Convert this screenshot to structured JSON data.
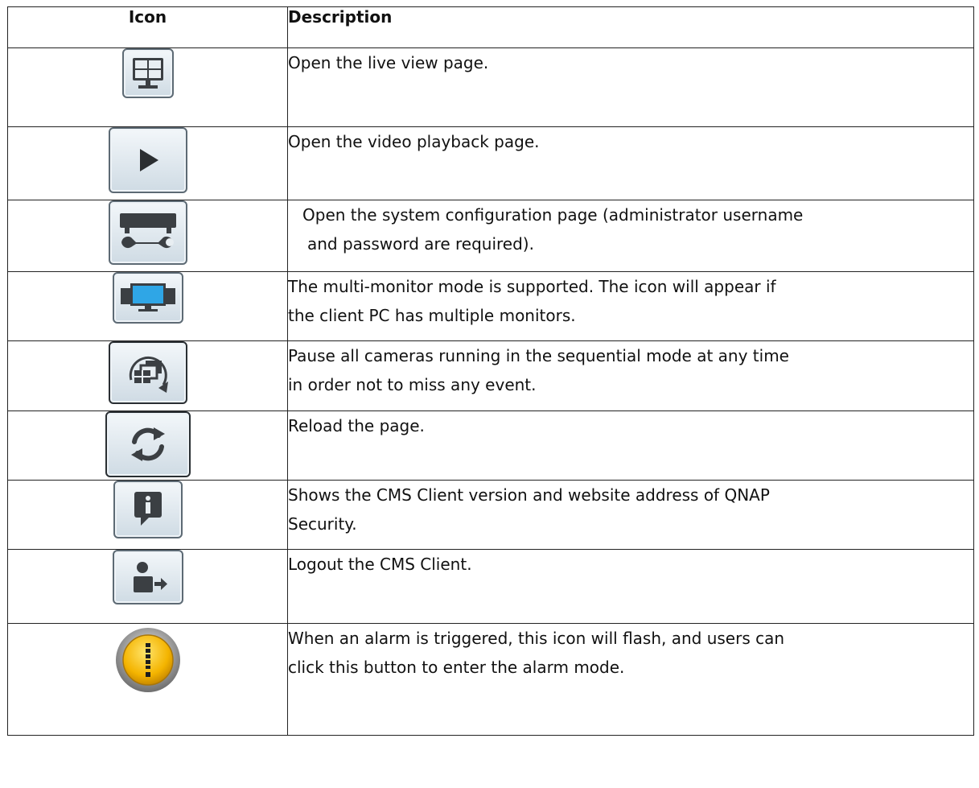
{
  "table": {
    "headers": {
      "icon": "Icon",
      "description": "Description"
    },
    "rows": [
      {
        "icon": "live-view-monitor-icon",
        "description_lines": [
          "Open the live view page."
        ]
      },
      {
        "icon": "playback-icon",
        "description_lines": [
          "Open the video playback page."
        ]
      },
      {
        "icon": "system-config-icon",
        "description_lines": [
          "Open the system configuration page (administrator username",
          "and password are required)."
        ]
      },
      {
        "icon": "multi-monitor-icon",
        "description_lines": [
          "The multi-monitor mode is supported. The icon will appear if",
          "the client PC has multiple monitors."
        ]
      },
      {
        "icon": "pause-sequential-icon",
        "description_lines": [
          "Pause all cameras running in the sequential mode at any time",
          "in order not to miss any event."
        ]
      },
      {
        "icon": "reload-icon",
        "description_lines": [
          "Reload the page."
        ]
      },
      {
        "icon": "info-icon",
        "description_lines": [
          "Shows the CMS Client version and website address of QNAP",
          "Security."
        ]
      },
      {
        "icon": "logout-icon",
        "description_lines": [
          "Logout the CMS Client."
        ]
      },
      {
        "icon": "alarm-icon",
        "description_lines": [
          "When an alarm is triggered, this icon will flash, and users can",
          "click this button to enter the alarm mode."
        ]
      }
    ]
  },
  "colors": {
    "icon_dark": "#3b3f43",
    "screen_blue": "#2fa6e6",
    "alarm_yellow": "#f4b400",
    "button_border": "#5d6a74"
  }
}
